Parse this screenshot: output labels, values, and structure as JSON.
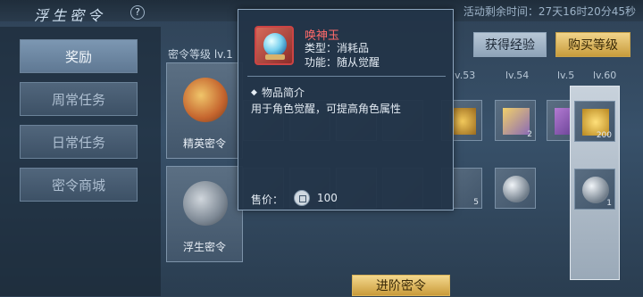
{
  "header": {
    "title": "浮生密令",
    "help": "?",
    "countdown": "活动剩余时间：27天16时20分45秒"
  },
  "nav": {
    "items": [
      "奖励",
      "周常任务",
      "日常任务",
      "密令商城"
    ],
    "active": 0
  },
  "level": {
    "header": "密令等级",
    "header_level": "lv.1",
    "columns": [
      "lv.53",
      "lv.54",
      "lv.5",
      "lv.60"
    ]
  },
  "actions": {
    "get_exp": "获得经验",
    "buy_level": "购买等级",
    "advance": "进阶密令"
  },
  "rows": [
    {
      "label": "精英密令"
    },
    {
      "label": "浮生密令"
    }
  ],
  "slots": {
    "elite_qty_1": "2",
    "elite_qty_60": "200",
    "fusheng_qty_1": "5",
    "fusheng_qty_60": "1"
  },
  "tooltip": {
    "name": "唤神玉",
    "type": "类型：消耗品",
    "function": "功能：随从觉醒",
    "section_title": "物品简介",
    "description": "用于角色觉醒，可提高角色属性",
    "price_label": "售价：",
    "price": "100"
  },
  "colors": {
    "accent": "#ff6a6a",
    "gold": "#c89c3c"
  }
}
